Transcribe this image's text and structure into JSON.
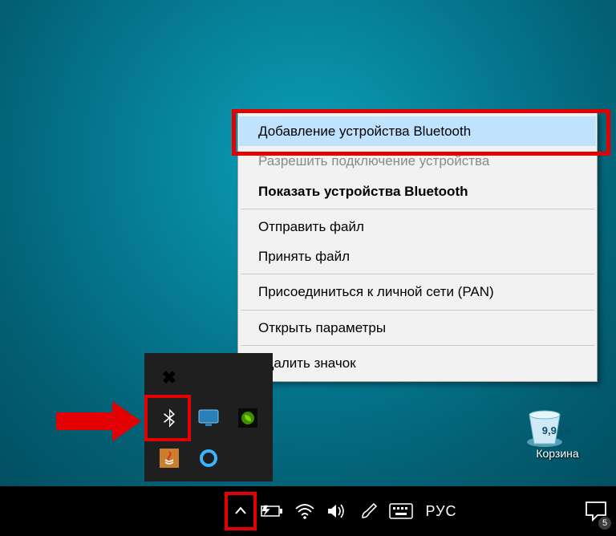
{
  "context_menu": {
    "items": [
      {
        "label": "Добавление устройства Bluetooth",
        "state": "hover"
      },
      {
        "label": "Разрешить подключение устройства",
        "state": "disabled"
      },
      {
        "label": "Показать устройства Bluetooth",
        "state": "bold"
      },
      {
        "sep": true
      },
      {
        "label": "Отправить файл",
        "state": ""
      },
      {
        "label": "Принять файл",
        "state": ""
      },
      {
        "sep": true
      },
      {
        "label": "Присоединиться к личной сети (PAN)",
        "state": ""
      },
      {
        "sep": true
      },
      {
        "label": "Открыть параметры",
        "state": ""
      },
      {
        "sep": true
      },
      {
        "label": "Удалить значок",
        "state": ""
      }
    ]
  },
  "tray_popup_icons": {
    "row0": [
      "crossed",
      "",
      ""
    ],
    "row1": [
      "bluetooth",
      "monitor",
      "nvidia"
    ],
    "row2": [
      "java",
      "circle",
      ""
    ]
  },
  "taskbar": {
    "lang": "РУС",
    "notif_badge": "5"
  },
  "recycle_bin": {
    "size": "9,9 ГБ",
    "label": "Корзина"
  },
  "annotations": {
    "arrow_to_bluetooth": true,
    "arrow_to_chevron": true,
    "box_first_menu_item": true,
    "box_bluetooth_tray": true,
    "box_chevron": true
  }
}
